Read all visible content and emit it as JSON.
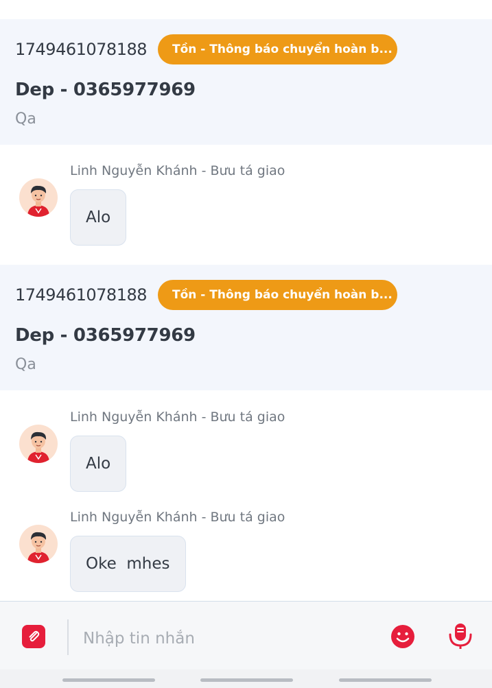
{
  "orders": [
    {
      "code": "1749461078188",
      "badge": "Tồn - Thông báo chuyển hoàn b...",
      "title": "Dep - 0365977969",
      "note": "Qa"
    },
    {
      "code": "1749461078188",
      "badge": "Tồn - Thông báo chuyển hoàn b...",
      "title": "Dep - 0365977969",
      "note": "Qa"
    }
  ],
  "messages": [
    {
      "sender": "Linh Nguyễn Khánh - Bưu tá giao",
      "text": "Alo"
    },
    {
      "sender": "Linh Nguyễn Khánh - Bưu tá giao",
      "text": "Alo"
    },
    {
      "sender": "Linh Nguyễn Khánh - Bưu tá giao",
      "text": "Oke  mhes"
    }
  ],
  "composer": {
    "placeholder": "Nhập tin nhắn",
    "attach_icon": "attachment-icon",
    "emoji_icon": "emoji-icon",
    "voice_icon": "microphone-icon"
  },
  "colors": {
    "badge": "#ee9a16",
    "accent": "#e61e3c",
    "order_bg": "#f3f6fc"
  }
}
